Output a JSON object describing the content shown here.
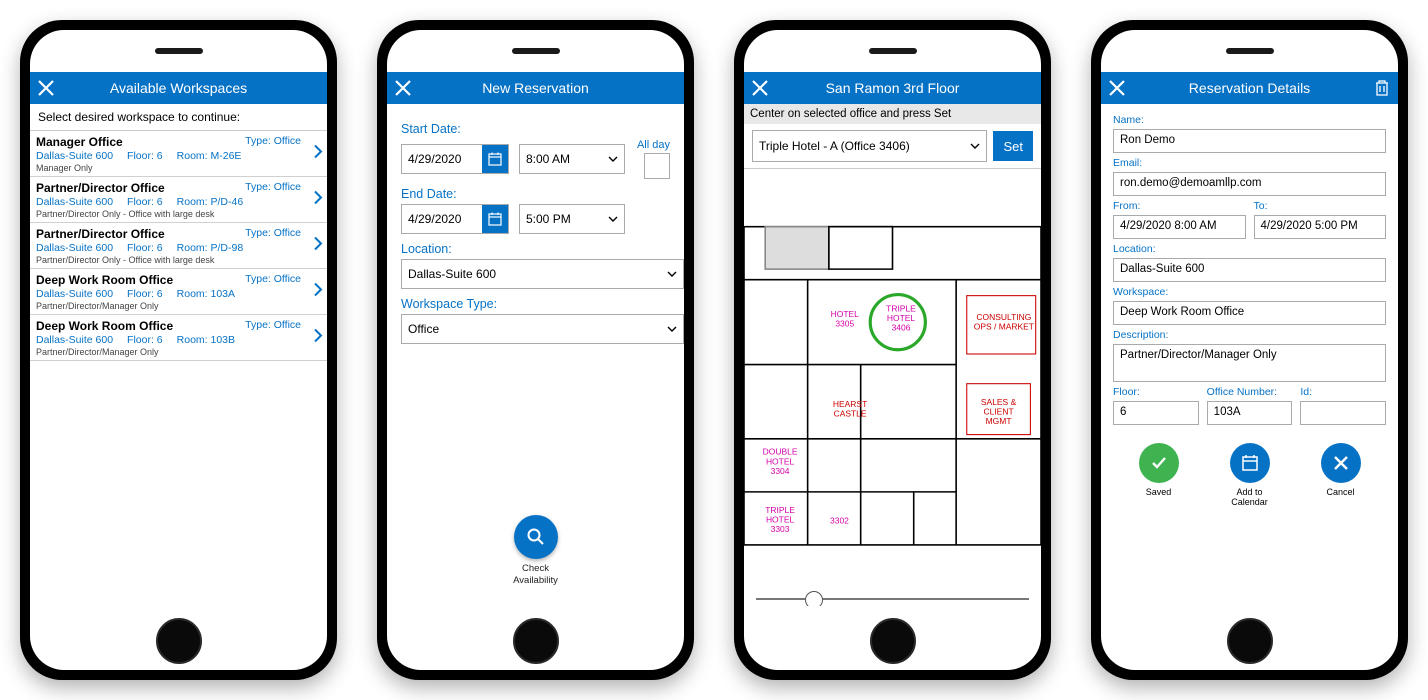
{
  "screen1": {
    "title": "Available Workspaces",
    "instruction": "Select desired workspace to continue:",
    "items": [
      {
        "name": "Manager Office",
        "type_label": "Type: Office",
        "location": "Dallas-Suite 600",
        "floor": "Floor: 6",
        "room": "Room: M-26E",
        "desc": "Manager Only"
      },
      {
        "name": "Partner/Director Office",
        "type_label": "Type: Office",
        "location": "Dallas-Suite 600",
        "floor": "Floor: 6",
        "room": "Room: P/D-46",
        "desc": "Partner/Director Only - Office with large desk"
      },
      {
        "name": "Partner/Director Office",
        "type_label": "Type: Office",
        "location": "Dallas-Suite 600",
        "floor": "Floor: 6",
        "room": "Room: P/D-98",
        "desc": "Partner/Director Only - Office with large desk"
      },
      {
        "name": "Deep Work Room Office",
        "type_label": "Type: Office",
        "location": "Dallas-Suite 600",
        "floor": "Floor: 6",
        "room": "Room: 103A",
        "desc": "Partner/Director/Manager Only"
      },
      {
        "name": "Deep Work Room Office",
        "type_label": "Type: Office",
        "location": "Dallas-Suite 600",
        "floor": "Floor: 6",
        "room": "Room: 103B",
        "desc": "Partner/Director/Manager Only"
      }
    ]
  },
  "screen2": {
    "title": "New Reservation",
    "start_label": "Start Date:",
    "end_label": "End Date:",
    "allday_label": "All day",
    "start_date": "4/29/2020",
    "start_time": "8:00 AM",
    "end_date": "4/29/2020",
    "end_time": "5:00 PM",
    "location_label": "Location:",
    "location_value": "Dallas-Suite 600",
    "wstype_label": "Workspace Type:",
    "wstype_value": "Office",
    "check_label": "Check\nAvailability"
  },
  "screen3": {
    "title": "San Ramon 3rd Floor",
    "instruction": "Center on selected office and press Set",
    "selected_office": "Triple Hotel - A (Office 3406)",
    "set_label": "Set",
    "map_labels": {
      "hotel_3305": "HOTEL\n3305",
      "triple_hotel_3406": "TRIPLE\nHOTEL\n3406",
      "consulting": "CONSULTING\nOPS / MARKET",
      "double_hotel_3304": "DOUBLE\nHOTEL\n3304",
      "hearst_castle": "HEARST\nCASTLE",
      "sales": "SALES &\nCLIENT\nMGMT",
      "triple_hotel_3303": "TRIPLE\nHOTEL\n3303",
      "r3302": "3302"
    }
  },
  "screen4": {
    "title": "Reservation Details",
    "name_label": "Name:",
    "name_value": "Ron Demo",
    "email_label": "Email:",
    "email_value": "ron.demo@demoamllp.com",
    "from_label": "From:",
    "from_value": "4/29/2020 8:00 AM",
    "to_label": "To:",
    "to_value": "4/29/2020 5:00 PM",
    "location_label": "Location:",
    "location_value": "Dallas-Suite 600",
    "workspace_label": "Workspace:",
    "workspace_value": "Deep Work Room Office",
    "description_label": "Description:",
    "description_value": "Partner/Director/Manager Only",
    "floor_label": "Floor:",
    "floor_value": "6",
    "office_label": "Office Number:",
    "office_value": "103A",
    "id_label": "Id:",
    "id_value": "",
    "saved_label": "Saved",
    "addcal_label": "Add to\nCalendar",
    "cancel_label": "Cancel"
  }
}
